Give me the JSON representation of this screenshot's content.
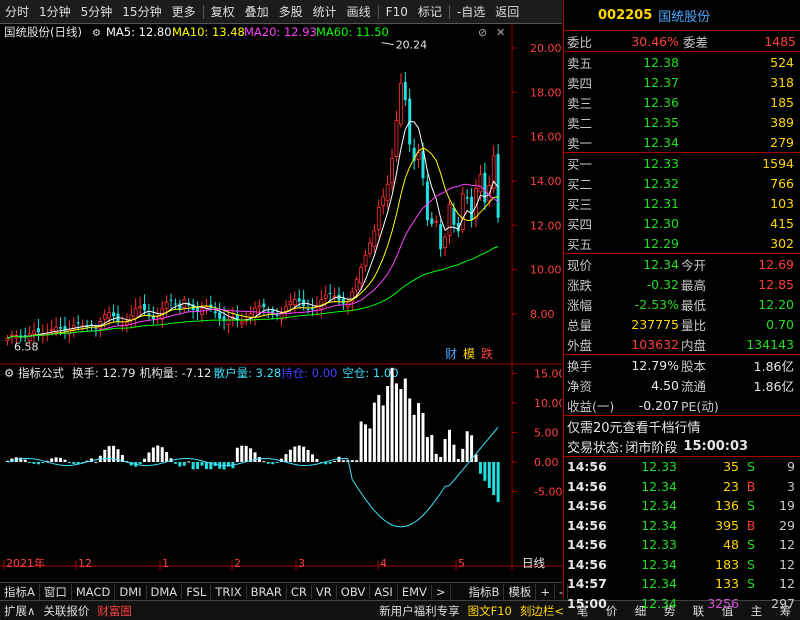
{
  "toolbar": {
    "items": [
      "分时",
      "1分钟",
      "5分钟",
      "15分钟",
      "更多",
      "复权",
      "叠加",
      "多股",
      "统计",
      "画线",
      "F10",
      "标记",
      "-自选",
      "返回"
    ]
  },
  "main_chart": {
    "title": "国统股份(日线)",
    "ma5": "MA5: 12.80",
    "ma10": "MA10: 13.48",
    "ma20": "MA20: 12.93",
    "ma60": "MA60: 11.50",
    "high_label": "20.24",
    "low_label": "6.58",
    "y_ticks": [
      "20.00",
      "18.00",
      "16.00",
      "14.00",
      "12.00",
      "10.00",
      "8.00"
    ],
    "y_tick_values": [
      20,
      18,
      16,
      14,
      12,
      10,
      8
    ],
    "badges": [
      "财",
      "模",
      "跌"
    ],
    "colors": {
      "ma5": "#ffffff",
      "ma10": "#ffff00",
      "ma20": "#ff40ff",
      "ma60": "#00ff00",
      "axis": "#a00000"
    }
  },
  "indicator": {
    "title": "指标公式",
    "values": [
      "换手: 12.79",
      "机构量: -7.12",
      "散户量: 3.28",
      "持仓: 0.00",
      "空仓: 1.00"
    ],
    "value_colors": [
      "#e6e6e6",
      "#e6e6e6",
      "#40e0ff",
      "#4040ff",
      "#40e0ff"
    ],
    "y_ticks": [
      "15.00",
      "10.00",
      "5.00",
      "0.00",
      "-5.00"
    ],
    "y_tick_values": [
      15,
      10,
      5,
      0,
      -5
    ]
  },
  "x_axis": {
    "labels": [
      "2021年",
      "12",
      "1",
      "2",
      "3",
      "4",
      "5"
    ],
    "corner": "日线"
  },
  "bottom_tabs": [
    "指标A",
    "窗口",
    "MACD",
    "DMI",
    "DMA",
    "FSL",
    "TRIX",
    "BRAR",
    "CR",
    "VR",
    "OBV",
    "ASI",
    "EMV",
    ">",
    "指标B",
    "模板",
    "+",
    "-"
  ],
  "bottom_bar": {
    "left": [
      "扩展∧",
      "关联报价",
      "财富圈"
    ],
    "promo": "新用户福利专享",
    "mid": [
      "图文F10",
      "刻边栏<"
    ],
    "icons": [
      "笔",
      "价",
      "细",
      "势",
      "联",
      "值",
      "主",
      "筹"
    ]
  },
  "quote": {
    "code": "002205",
    "name": "国统股份",
    "weibi_label": "委比",
    "weibi": "30.46%",
    "weicha_label": "委差",
    "weicha": "1485",
    "sell": [
      {
        "label": "卖五",
        "price": "12.38",
        "vol": "524"
      },
      {
        "label": "卖四",
        "price": "12.37",
        "vol": "318"
      },
      {
        "label": "卖三",
        "price": "12.36",
        "vol": "185"
      },
      {
        "label": "卖二",
        "price": "12.35",
        "vol": "389"
      },
      {
        "label": "卖一",
        "price": "12.34",
        "vol": "279"
      }
    ],
    "buy": [
      {
        "label": "买一",
        "price": "12.33",
        "vol": "1594"
      },
      {
        "label": "买二",
        "price": "12.32",
        "vol": "766"
      },
      {
        "label": "买三",
        "price": "12.31",
        "vol": "103"
      },
      {
        "label": "买四",
        "price": "12.30",
        "vol": "415"
      },
      {
        "label": "买五",
        "price": "12.29",
        "vol": "302"
      }
    ],
    "stats": [
      {
        "l1": "现价",
        "v1": "12.34",
        "c1": "grn",
        "l2": "今开",
        "v2": "12.69",
        "c2": "red"
      },
      {
        "l1": "涨跌",
        "v1": "-0.32",
        "c1": "grn",
        "l2": "最高",
        "v2": "12.85",
        "c2": "red"
      },
      {
        "l1": "涨幅",
        "v1": "-2.53%",
        "c1": "grn",
        "l2": "最低",
        "v2": "12.20",
        "c2": "grn"
      },
      {
        "l1": "总量",
        "v1": "237775",
        "c1": "yel",
        "l2": "量比",
        "v2": "0.70",
        "c2": "grn"
      },
      {
        "l1": "外盘",
        "v1": "103632",
        "c1": "red",
        "l2": "内盘",
        "v2": "134143",
        "c2": "grn"
      }
    ],
    "stats2": [
      {
        "l1": "换手",
        "v1": "12.79%",
        "l2": "股本",
        "v2": "1.86亿"
      },
      {
        "l1": "净资",
        "v1": "4.50",
        "l2": "流通",
        "v2": "1.86亿"
      },
      {
        "l1": "收益(一)",
        "v1": "-0.207",
        "l2": "PE(动)",
        "v2": ""
      }
    ],
    "promo": "仅需20元查看千档行情",
    "status_label": "交易状态:",
    "status": "闭市阶段",
    "status_time": "15:00:03",
    "ticks": [
      {
        "t": "14:56",
        "p": "12.33",
        "v": "35",
        "d": "S",
        "n": "9"
      },
      {
        "t": "14:56",
        "p": "12.34",
        "v": "23",
        "d": "B",
        "n": "3"
      },
      {
        "t": "14:56",
        "p": "12.34",
        "v": "136",
        "d": "S",
        "n": "19"
      },
      {
        "t": "14:56",
        "p": "12.34",
        "v": "395",
        "d": "B",
        "n": "29"
      },
      {
        "t": "14:56",
        "p": "12.33",
        "v": "48",
        "d": "S",
        "n": "12"
      },
      {
        "t": "14:56",
        "p": "12.34",
        "v": "183",
        "d": "S",
        "n": "12"
      },
      {
        "t": "14:57",
        "p": "12.34",
        "v": "133",
        "d": "S",
        "n": "12"
      },
      {
        "t": "15:00",
        "p": "12.34",
        "v": "3256",
        "d": "",
        "n": "297"
      }
    ]
  }
}
